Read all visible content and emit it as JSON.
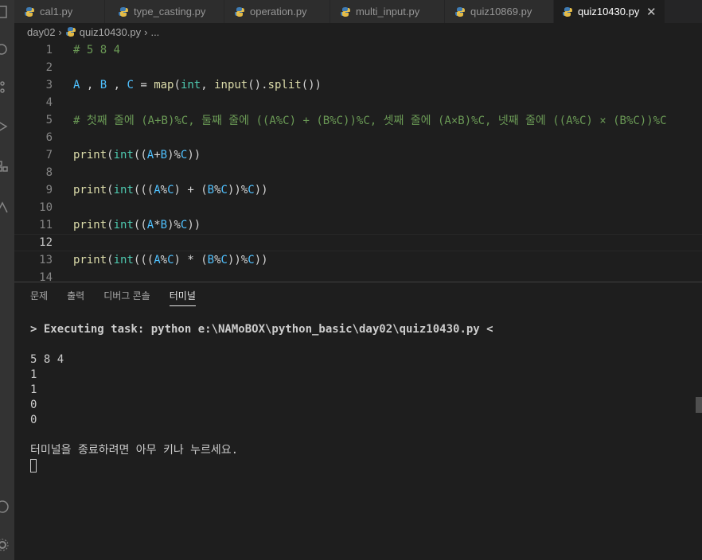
{
  "tabs": [
    {
      "label": "cal1.py",
      "active": false
    },
    {
      "label": "type_casting.py",
      "active": false
    },
    {
      "label": "operation.py",
      "active": false
    },
    {
      "label": "multi_input.py",
      "active": false
    },
    {
      "label": "quiz10869.py",
      "active": false
    },
    {
      "label": "quiz10430.py",
      "active": true
    }
  ],
  "tab_close_glyph": "✕",
  "breadcrumb": {
    "folder": "day02",
    "file": "quiz10430.py",
    "ellipsis": "..."
  },
  "editor": {
    "current_line": 12,
    "line_numbers": [
      "1",
      "2",
      "3",
      "4",
      "5",
      "6",
      "7",
      "8",
      "9",
      "10",
      "11",
      "12",
      "13",
      "14"
    ],
    "line1": "# 5 8 4",
    "line3": {
      "a": "A",
      "comma1": " , ",
      "b": "B",
      "comma2": " , ",
      "c": "C",
      "eq": " = ",
      "map": "map",
      "p1": "(",
      "int": "int",
      "comma3": ", ",
      "input": "input",
      "p2": "().",
      "split": "split",
      "p3": "())"
    },
    "line5": "# 첫째 줄에 (A+B)%C, 둘째 줄에 ((A%C) + (B%C))%C, 셋째 줄에 (A×B)%C, 넷째 줄에 ((A%C) × (B%C))%C",
    "line7": "print(int((A+B)%C))",
    "line9": "print(int(((A%C) + (B%C))%C))",
    "line11": "print(int((A*B)%C))",
    "line13": "print(int(((A%C) * (B%C))%C))"
  },
  "panel": {
    "tabs": [
      "문제",
      "출력",
      "디버그 콘솔",
      "터미널"
    ],
    "active_tab": "터미널",
    "terminal_lines": [
      "> Executing task: python e:\\NAMoBOX\\python_basic\\day02\\quiz10430.py <",
      "",
      "5 8 4",
      "1",
      "1",
      "0",
      "0",
      "",
      "터미널을 종료하려면 아무 키나 누르세요."
    ]
  },
  "colors": {
    "background": "#1e1e1e",
    "comment": "#6a9955",
    "variable": "#4fc1ff",
    "function": "#dcdcaa",
    "type": "#4ec9b0"
  },
  "icons": [
    "python-file-icon",
    "close-icon",
    "chevron-right-icon"
  ]
}
